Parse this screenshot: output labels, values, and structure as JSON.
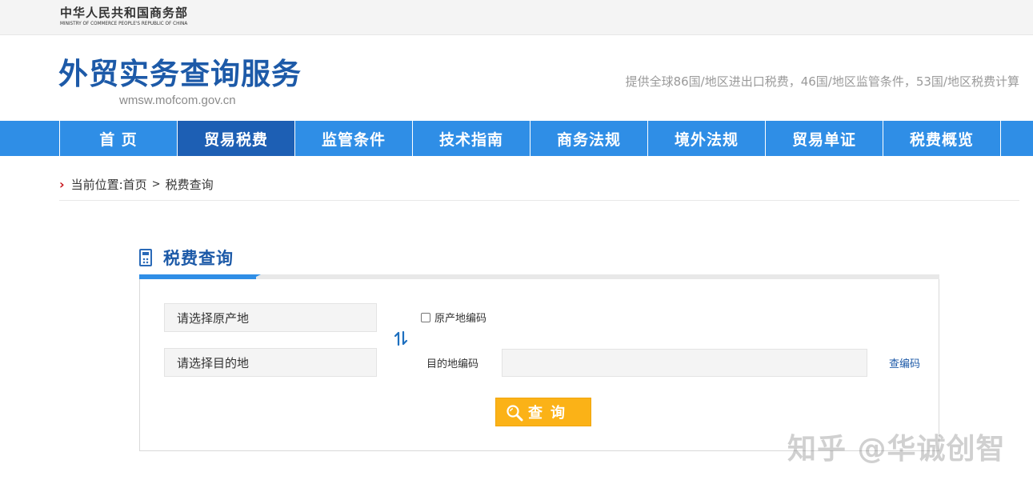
{
  "header": {
    "ministry_cn": "中华人民共和国商务部",
    "ministry_en": "MINISTRY OF COMMERCE PEOPLE'S REPUBLIC OF CHINA",
    "site_title": "外贸实务查询服务",
    "site_domain": "wmsw.mofcom.gov.cn",
    "slogan": "提供全球86国/地区进出口税费，46国/地区监管条件，53国/地区税费计算"
  },
  "nav": {
    "items": [
      {
        "label": "首 页"
      },
      {
        "label": "贸易税费"
      },
      {
        "label": "监管条件"
      },
      {
        "label": "技术指南"
      },
      {
        "label": "商务法规"
      },
      {
        "label": "境外法规"
      },
      {
        "label": "贸易单证"
      },
      {
        "label": "税费概览"
      }
    ],
    "active_index": 1
  },
  "breadcrumb": {
    "prefix": "当前位置:",
    "home": "首页",
    "separator": ">",
    "current": "税费查询"
  },
  "section": {
    "title": "税费查询"
  },
  "form": {
    "origin_placeholder": "请选择原产地",
    "dest_placeholder": "请选择目的地",
    "origin_code_label": "原产地编码",
    "origin_code_checked": false,
    "dest_code_label": "目的地编码",
    "dest_code_value": "",
    "lookup_link": "查编码",
    "query_button": "查询"
  },
  "watermark": "知乎 @华诚创智",
  "colors": {
    "brand_blue": "#1d5aa8",
    "nav_blue": "#2f8ee6",
    "nav_active": "#1d5fb4",
    "button_yellow": "#fbb217",
    "breadcrumb_arrow": "#c8161d"
  }
}
